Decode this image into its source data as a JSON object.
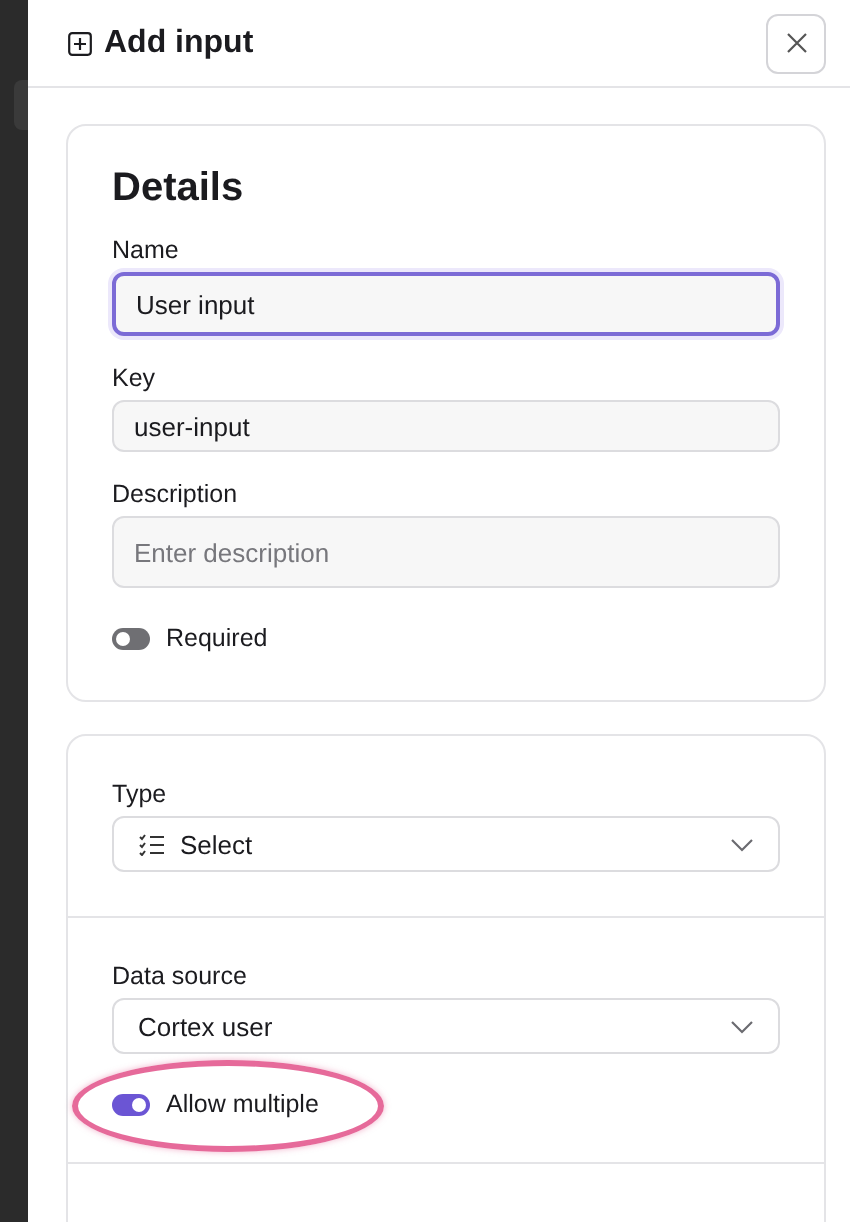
{
  "header": {
    "title": "Add input"
  },
  "details": {
    "title": "Details",
    "fields": [
      {
        "label": "Name",
        "value": "User input",
        "focused": true
      },
      {
        "label": "Key",
        "value": "user-input",
        "focused": false
      },
      {
        "label": "Description",
        "placeholder": "Enter description",
        "focused": false
      }
    ],
    "toggles": [
      {
        "label": "Required",
        "on": false,
        "highlighted": false
      }
    ]
  },
  "type": {
    "label": "Type",
    "value": "Select"
  },
  "data_source": {
    "label": "Data source",
    "value": "Cortex user",
    "toggles": [
      {
        "label": "Allow multiple",
        "on": true,
        "highlighted": true
      }
    ]
  }
}
